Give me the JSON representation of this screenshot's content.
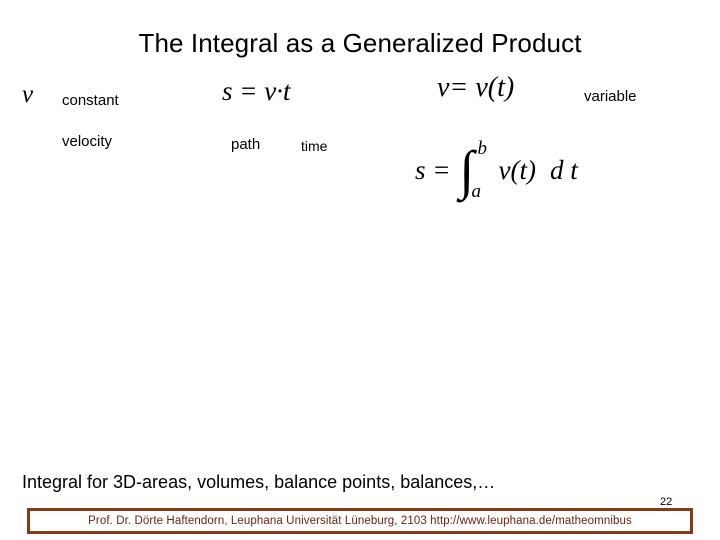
{
  "slide": {
    "title": "The Integral as a Generalized Product",
    "page_number": "22",
    "caption": "Integral for 3D-areas, volumes, balance points, balances,…"
  },
  "constant_block": {
    "symbol": "v",
    "label_constant": "constant",
    "label_velocity": "velocity"
  },
  "product_equation": {
    "formula": "s = v·t",
    "label_path": "path",
    "label_time": "time"
  },
  "variable_block": {
    "formula": "v= v(t)",
    "label_variable": "variable"
  },
  "integral_equation": {
    "lhs": "s =",
    "integral_sign": "∫",
    "upper_limit": "b",
    "lower_limit": "a",
    "integrand": "v(t)",
    "differential": "d t"
  },
  "footer": {
    "text": "Prof. Dr. Dörte Haftendorn, Leuphana Universität Lüneburg, 2103 http://www.leuphana.de/matheomnibus",
    "accent_color": "#8a3a12",
    "text_color": "#6b2410"
  }
}
